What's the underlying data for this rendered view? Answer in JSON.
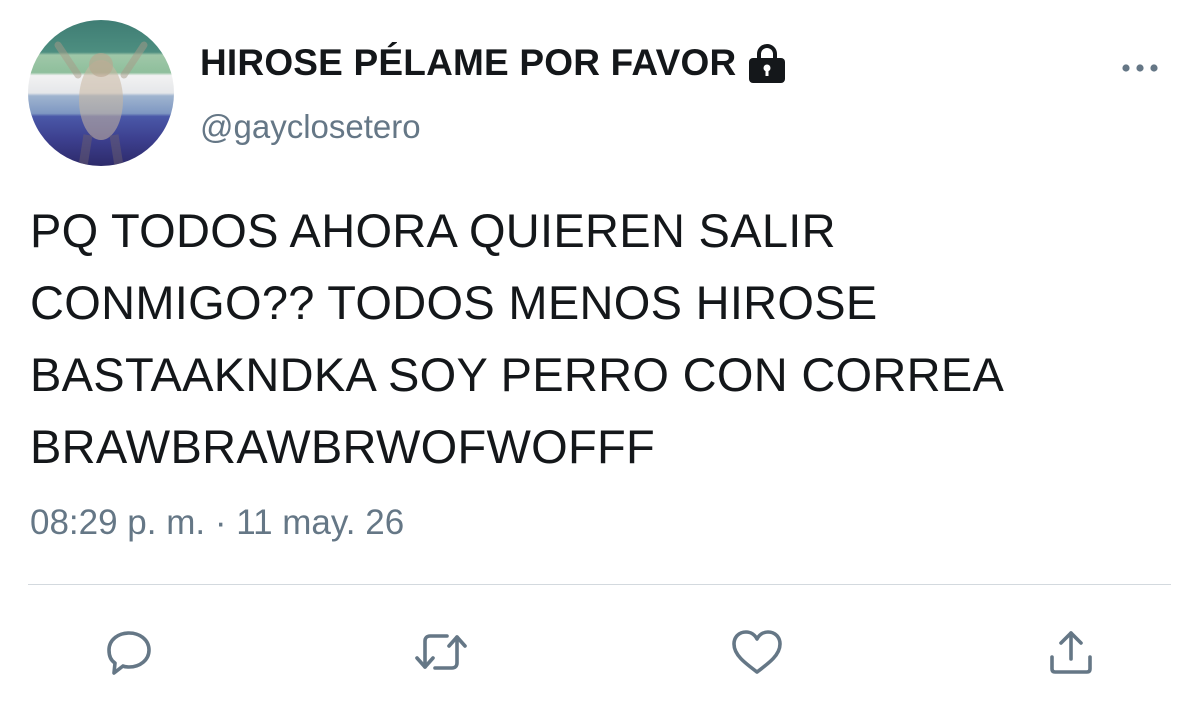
{
  "tweet": {
    "author": {
      "display_name": "HIROSE PÉLAME POR FAVOR",
      "handle": "@gayclosetero",
      "protected_icon": "lock-icon"
    },
    "text": "PQ TODOS AHORA QUIEREN SALIR\nCONMIGO?? TODOS MENOS HIROSE\nBASTAAKNDKA SOY PERRO CON CORREA\nBRAWBRAWBRWOFWOFFF",
    "timestamp": "08:29 p. m. · 11 may. 26",
    "actions": [
      {
        "name": "reply",
        "icon": "comment-icon"
      },
      {
        "name": "retweet",
        "icon": "retweet-icon"
      },
      {
        "name": "like",
        "icon": "heart-icon"
      },
      {
        "name": "share",
        "icon": "share-icon"
      }
    ]
  },
  "colors": {
    "text_primary": "#14171a",
    "text_secondary": "#657786",
    "icon": "#657786",
    "divider": "#d3d9de"
  }
}
